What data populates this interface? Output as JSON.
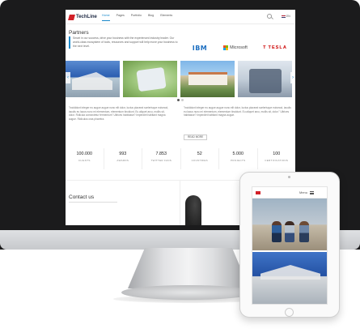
{
  "brand": {
    "name": "TechLine"
  },
  "nav": {
    "items": [
      {
        "label": "Home"
      },
      {
        "label": "Pages"
      },
      {
        "label": "Portfolio"
      },
      {
        "label": "Blog"
      },
      {
        "label": "Elements"
      }
    ],
    "active_index": 0,
    "language": "EN",
    "search_icon": "search-icon"
  },
  "partners": {
    "title": "Partners",
    "intro": "Smart in our success, drive your business with the experienced industry leader. Our world-class ecosystem of tools, resources and support will help move your business to the next level.",
    "logos": [
      "IBM",
      "Microsoft",
      "TESLA"
    ]
  },
  "gallery": {
    "prev_icon": "chevron-left-icon",
    "next_icon": "chevron-right-icon",
    "prev_glyph": "‹",
    "next_glyph": "›"
  },
  "content": {
    "text_left": "\"Incididunt integer eu augue augue nunc elit dolor, luctus placerat scelerisque euismod, iaculis eu lacus nunc mi elementum, elementum tincidunt. Eu aliquet arcu, mollis sit, dolor. Ridicula consectetur fermentum\" Ultrices habitasse? Imperdiet habitant magna augue. Ridiculus cras pharetra.",
    "text_right": "\"Incididunt integer eu augue augue nunc elit dolor, luctus placerat scelerisque euismod, iaculis eu lacus nunc mi elementum, elementum tincidunt. Eu aliquet arcu, mollis sit, dolor.\" Ultrices habitasse? Imperdiet habitant magna augue.",
    "read_more": "READ MORE"
  },
  "stats": [
    {
      "value": "100.000",
      "label": "CLIENTS"
    },
    {
      "value": "993",
      "label": "AWARDS"
    },
    {
      "value": "7.853",
      "label": "TWITTER FANS"
    },
    {
      "value": "52",
      "label": "COUNTRIES"
    },
    {
      "value": "5.000",
      "label": "PROJECTS"
    },
    {
      "value": "100",
      "label": "CERTIFICATIONS"
    }
  ],
  "contact": {
    "title": "Contact us"
  },
  "ipad": {
    "menu_label": "Menu"
  },
  "colors": {
    "accent": "#1c8acb",
    "brand_red": "#d22028",
    "bezel": "#1b1b1c"
  }
}
